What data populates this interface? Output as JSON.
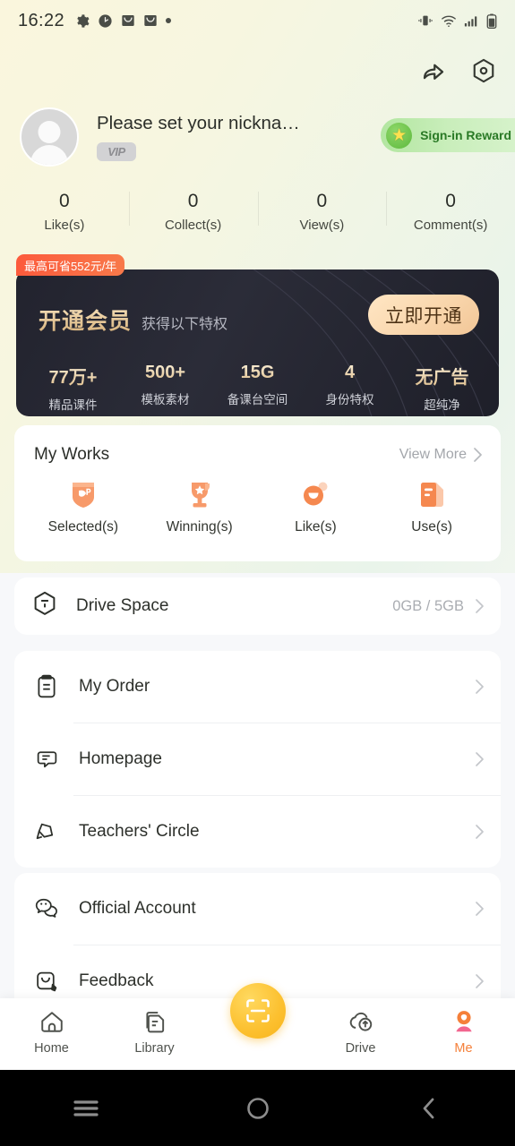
{
  "statusbar": {
    "time": "16:22",
    "left_icons": [
      "gear-icon",
      "clock-icon",
      "mail-icon",
      "mail-icon",
      "dot-icon"
    ],
    "right_icons": [
      "vibrate-icon",
      "wifi-icon",
      "signal-icon",
      "battery-icon"
    ]
  },
  "header": {
    "share_icon": "share-icon",
    "settings_icon": "settings-hexagon-icon"
  },
  "profile": {
    "nickname": "Please set your nickna…",
    "vip_badge": "VIP",
    "avatar_icon": "default-avatar-icon",
    "signin": {
      "label": "Sign-in Reward",
      "icon": "star-icon"
    },
    "stats": [
      {
        "value": "0",
        "label": "Like(s)"
      },
      {
        "value": "0",
        "label": "Collect(s)"
      },
      {
        "value": "0",
        "label": "View(s)"
      },
      {
        "value": "0",
        "label": "Comment(s)"
      }
    ]
  },
  "vip_banner": {
    "save_badge": "最高可省552元/年",
    "title": "开通会员",
    "subtitle": "获得以下特权",
    "cta": "立即开通",
    "features": [
      {
        "value": "77万+",
        "label": "精品课件"
      },
      {
        "value": "500+",
        "label": "模板素材"
      },
      {
        "value": "15G",
        "label": "备课台空间"
      },
      {
        "value": "4",
        "label": "身份特权"
      },
      {
        "value": "无广告",
        "label": "超纯净"
      }
    ],
    "colors": {
      "gold": "#e6c896",
      "card_bg": "#23242f",
      "badge": "#fc5a3c"
    }
  },
  "my_works": {
    "title": "My Works",
    "more_label": "View More",
    "items": [
      {
        "label": "Selected(s)",
        "icon": "shield-badge-icon"
      },
      {
        "label": "Winning(s)",
        "icon": "trophy-icon"
      },
      {
        "label": "Like(s)",
        "icon": "thumb-heart-icon"
      },
      {
        "label": "Use(s)",
        "icon": "document-pencil-icon"
      }
    ],
    "accent": "#f59563"
  },
  "drive_space": {
    "label": "Drive Space",
    "value": "0GB / 5GB",
    "icon": "drive-hexagon-icon"
  },
  "menu_group_1": [
    {
      "label": "My Order",
      "icon": "clipboard-icon"
    },
    {
      "label": "Homepage",
      "icon": "chat-bubble-icon"
    },
    {
      "label": "Teachers' Circle",
      "icon": "circle-bubble-icon"
    }
  ],
  "menu_group_2": [
    {
      "label": "Official Account",
      "icon": "wechat-icon"
    },
    {
      "label": "Feedback",
      "icon": "envelope-pencil-icon"
    }
  ],
  "bottom_nav": {
    "items": [
      {
        "label": "Home",
        "icon": "home-icon",
        "active": false
      },
      {
        "label": "Library",
        "icon": "library-icon",
        "active": false
      },
      {
        "label": "Drive",
        "icon": "cloud-upload-icon",
        "active": false
      },
      {
        "label": "Me",
        "icon": "person-icon",
        "active": true
      }
    ],
    "fab_icon": "scan-icon",
    "active_color": "#f5803a",
    "fab_color": "#fcc02f"
  },
  "android_nav": {
    "recents_icon": "menu-icon",
    "home_icon": "circle-icon",
    "back_icon": "back-chevron-icon"
  }
}
